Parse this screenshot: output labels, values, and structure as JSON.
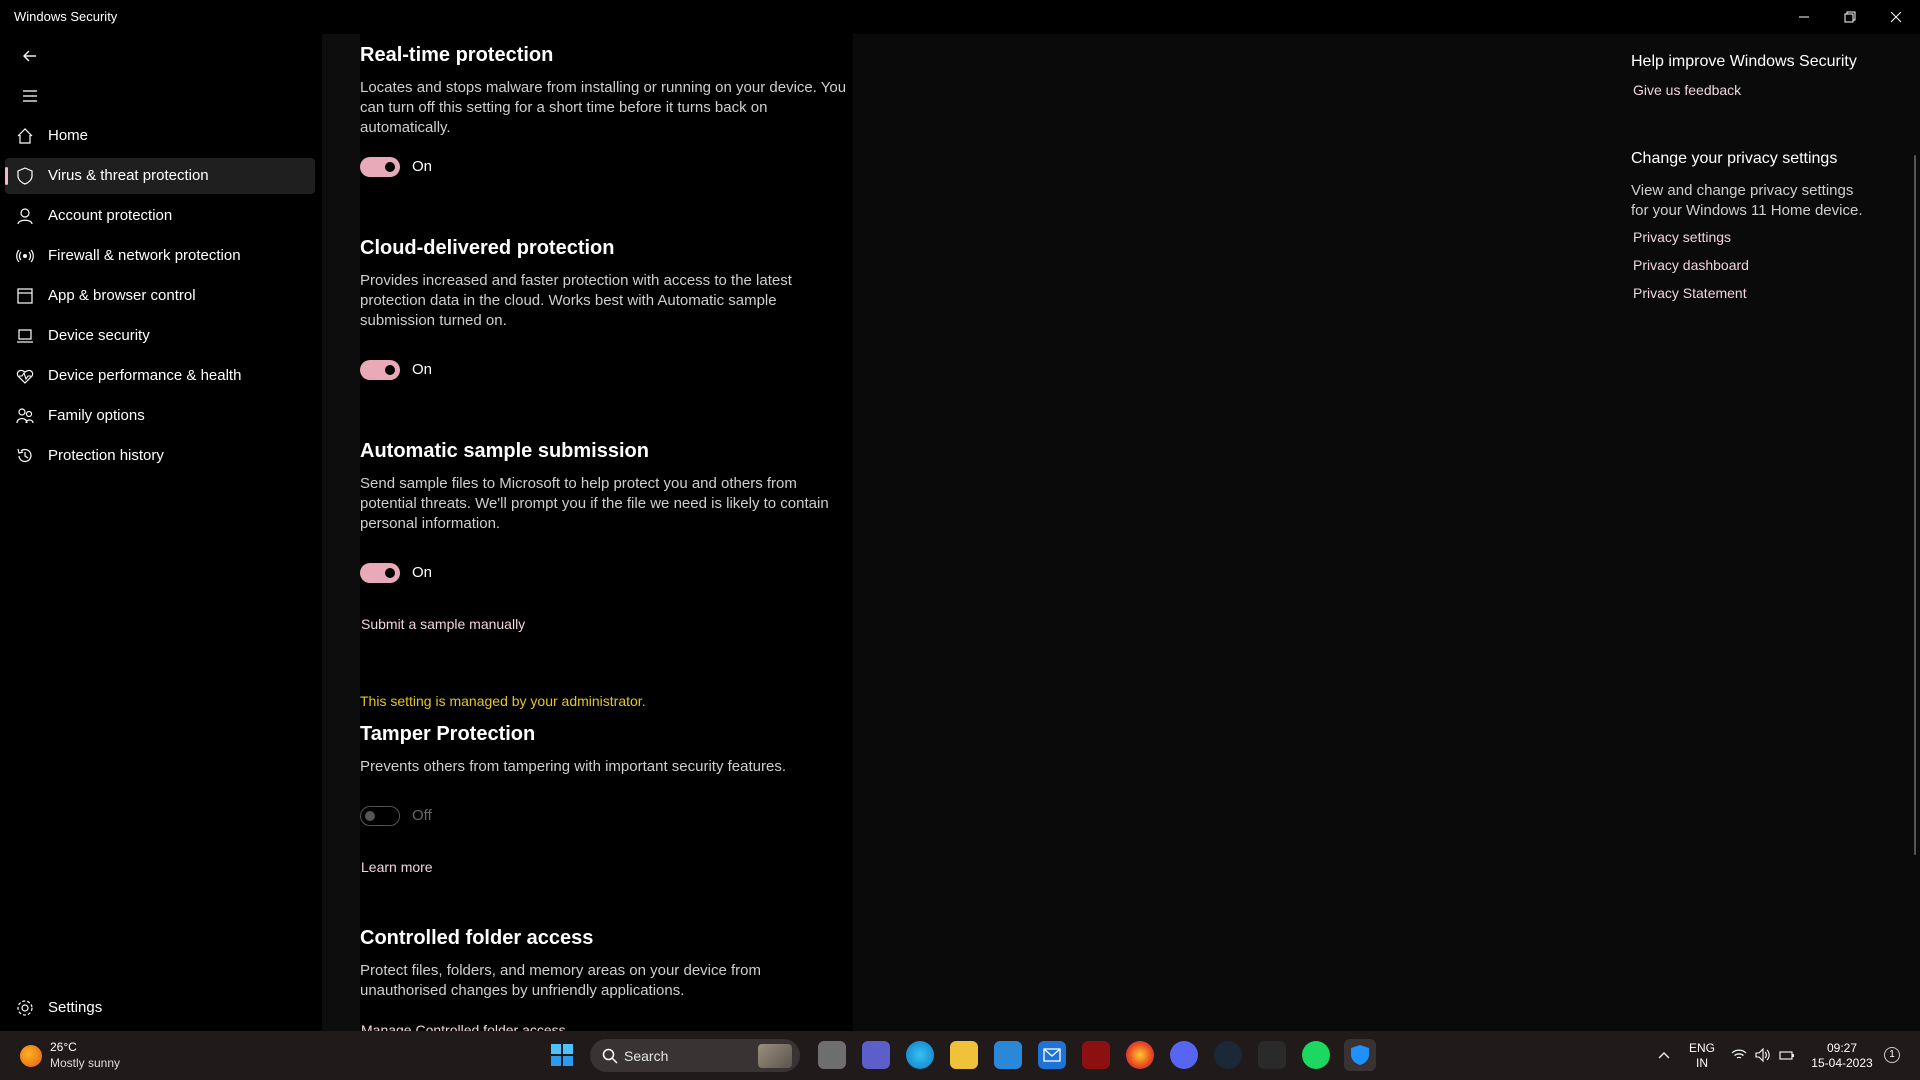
{
  "window": {
    "title": "Windows Security"
  },
  "sidebar": {
    "items": [
      {
        "label": "Home",
        "icon": "home-icon"
      },
      {
        "label": "Virus & threat protection",
        "icon": "shield-icon",
        "selected": true
      },
      {
        "label": "Account protection",
        "icon": "person-icon"
      },
      {
        "label": "Firewall & network protection",
        "icon": "wireless-icon"
      },
      {
        "label": "App & browser control",
        "icon": "app-window-icon"
      },
      {
        "label": "Device security",
        "icon": "laptop-icon"
      },
      {
        "label": "Device performance & health",
        "icon": "heart-pulse-icon"
      },
      {
        "label": "Family options",
        "icon": "family-icon"
      },
      {
        "label": "Protection history",
        "icon": "history-icon"
      }
    ],
    "settings_label": "Settings"
  },
  "sections": {
    "realtime": {
      "title": "Real-time protection",
      "description": "Locates and stops malware from installing or running on your device. You can turn off this setting for a short time before it turns back on automatically.",
      "state": "On"
    },
    "cloud": {
      "title": "Cloud-delivered protection",
      "description": "Provides increased and faster protection with access to the latest protection data in the cloud. Works best with Automatic sample submission turned on.",
      "state": "On"
    },
    "sample": {
      "title": "Automatic sample submission",
      "description": "Send sample files to Microsoft to help protect you and others from potential threats. We'll prompt you if the file we need is likely to contain personal information.",
      "state": "On",
      "link": "Submit a sample manually"
    },
    "tamper": {
      "admin_note": "This setting is managed by your administrator.",
      "title": "Tamper Protection",
      "description": "Prevents others from tampering with important security features.",
      "state": "Off",
      "link": "Learn more"
    },
    "cfa": {
      "title": "Controlled folder access",
      "description": "Protect files, folders, and memory areas on your device from unauthorised changes by unfriendly applications.",
      "link": "Manage Controlled folder access"
    }
  },
  "right_panel": {
    "help_heading": "Help improve Windows Security",
    "feedback_link": "Give us feedback",
    "privacy_heading": "Change your privacy settings",
    "privacy_desc": "View and change privacy settings for your Windows 11 Home device.",
    "privacy_links": [
      "Privacy settings",
      "Privacy dashboard",
      "Privacy Statement"
    ]
  },
  "taskbar": {
    "weather_temp": "26°C",
    "weather_desc": "Mostly sunny",
    "search_placeholder": "Search",
    "lang_line1": "ENG",
    "lang_line2": "IN",
    "time": "09:27",
    "date": "15-04-2023",
    "notification_count": "1",
    "apps": [
      "start",
      "widgets-news",
      "task-view",
      "teams",
      "edge",
      "file-explorer",
      "microsoft-store",
      "mail",
      "game-launcher",
      "firefox",
      "discord",
      "steam",
      "epic-games",
      "spotify",
      "windows-security"
    ]
  },
  "colors": {
    "accent": "#e8a9b8",
    "link": "#f0d5dc",
    "warning": "#e3c627",
    "taskbar": "#201a1a"
  }
}
